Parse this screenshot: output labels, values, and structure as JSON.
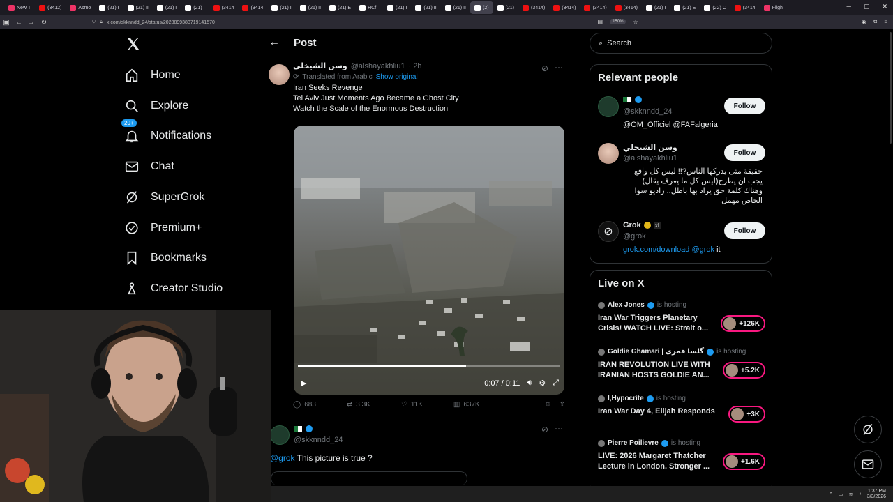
{
  "browser": {
    "tabs": [
      {
        "label": "New T",
        "fav": "generic"
      },
      {
        "label": "(3412)",
        "fav": "yt"
      },
      {
        "label": "Asmo",
        "fav": "generic"
      },
      {
        "label": "(21) I",
        "fav": "x"
      },
      {
        "label": "(21) II",
        "fav": "x"
      },
      {
        "label": "(21) I",
        "fav": "x"
      },
      {
        "label": "(21) I",
        "fav": "x"
      },
      {
        "label": "(3414",
        "fav": "yt"
      },
      {
        "label": "(3414",
        "fav": "yt"
      },
      {
        "label": "(21) I",
        "fav": "x"
      },
      {
        "label": "(21) II",
        "fav": "x"
      },
      {
        "label": "(21) E",
        "fav": "x"
      },
      {
        "label": "HCf_",
        "fav": "x"
      },
      {
        "label": "(21) I",
        "fav": "x"
      },
      {
        "label": "(21) II",
        "fav": "x"
      },
      {
        "label": "(21) II",
        "fav": "x"
      },
      {
        "label": "(2)",
        "fav": "x",
        "active": true
      },
      {
        "label": "(21)",
        "fav": "x"
      },
      {
        "label": "(3414)",
        "fav": "yt"
      },
      {
        "label": "(3414)",
        "fav": "yt"
      },
      {
        "label": "(3414)",
        "fav": "yt"
      },
      {
        "label": "(3414)",
        "fav": "yt"
      },
      {
        "label": "(21) I",
        "fav": "x"
      },
      {
        "label": "(21) E",
        "fav": "x"
      },
      {
        "label": "(22) C",
        "fav": "x"
      },
      {
        "label": "(3414",
        "fav": "yt"
      },
      {
        "label": "Fligh",
        "fav": "generic"
      }
    ],
    "url": "x.com/skknndd_24/status/2028899383719141570",
    "zoom": "150%"
  },
  "nav": {
    "items": [
      {
        "label": "Home",
        "icon": "home-icon"
      },
      {
        "label": "Explore",
        "icon": "search-icon"
      },
      {
        "label": "Notifications",
        "icon": "bell-icon",
        "badge": "20+"
      },
      {
        "label": "Chat",
        "icon": "mail-icon"
      },
      {
        "label": "SuperGrok",
        "icon": "grok-icon"
      },
      {
        "label": "Premium+",
        "icon": "verified-icon"
      },
      {
        "label": "Bookmarks",
        "icon": "bookmark-icon"
      },
      {
        "label": "Creator Studio",
        "icon": "creator-icon"
      }
    ]
  },
  "post": {
    "header": "Post",
    "author_name": "وسن الشيخلي",
    "author_handle": "@alshayakhliu1",
    "time": "· 2h",
    "translated": "Translated from Arabic",
    "show_original": "Show original",
    "lines": [
      "Iran Seeks Revenge",
      "Tel Aviv Just Moments Ago Became a Ghost City",
      "Watch the Scale of the Enormous Destruction"
    ],
    "video_time": "0:07 / 0:11",
    "video_progress": 0.64,
    "stats": {
      "replies": "683",
      "reposts": "3.3K",
      "likes": "11K",
      "views": "637K"
    }
  },
  "reply": {
    "handle": "@skknndd_24",
    "mention": "@grok",
    "text": " This picture is true ?"
  },
  "sidebar": {
    "search_placeholder": "Search",
    "relevant_title": "Relevant people",
    "people": [
      {
        "name": "",
        "handle": "@skknndd_24",
        "bio": "@OM_Officiel @FAFalgeria",
        "follow": "Follow"
      },
      {
        "name": "وسن الشيخلي",
        "handle": "@alshayakhliu1",
        "bio": "حقيقة متى يدركها الناس?!! ليس كل واقع يجب ان يطرح(ليس كل ما يعرف يقال) وهناك كلمة حق يراد بها باطل.. راديو سوا الخاص مهمل",
        "follow": "Follow"
      },
      {
        "name": "Grok",
        "handle": "@grok",
        "bio_link": "grok.com/download",
        "bio_mention": "@grok",
        "bio_tail": " it",
        "follow": "Follow"
      }
    ],
    "live_title": "Live on X",
    "live": [
      {
        "host": "Alex Jones",
        "status": "is hosting",
        "title": "Iran War Triggers Planetary Crisis! WATCH LIVE: Strait o...",
        "count": "+126K"
      },
      {
        "host": "Goldie Ghamari | گلسا قمری",
        "status": "is hosting",
        "title": "IRAN REVOLUTION LIVE WITH IRANIAN HOSTS GOLDIE AN...",
        "count": "+5.2K"
      },
      {
        "host": "I,Hypocrite",
        "status": "is hosting",
        "title": "Iran War Day 4, Elijah Responds",
        "count": "+3K"
      },
      {
        "host": "Pierre Poilievre",
        "status": "is hosting",
        "title": "LIVE: 2026 Margaret Thatcher Lecture in London. Stronger ...",
        "count": "+1.6K"
      }
    ]
  },
  "taskbar": {
    "time": "1:37 PM",
    "date": "3/3/2026"
  }
}
